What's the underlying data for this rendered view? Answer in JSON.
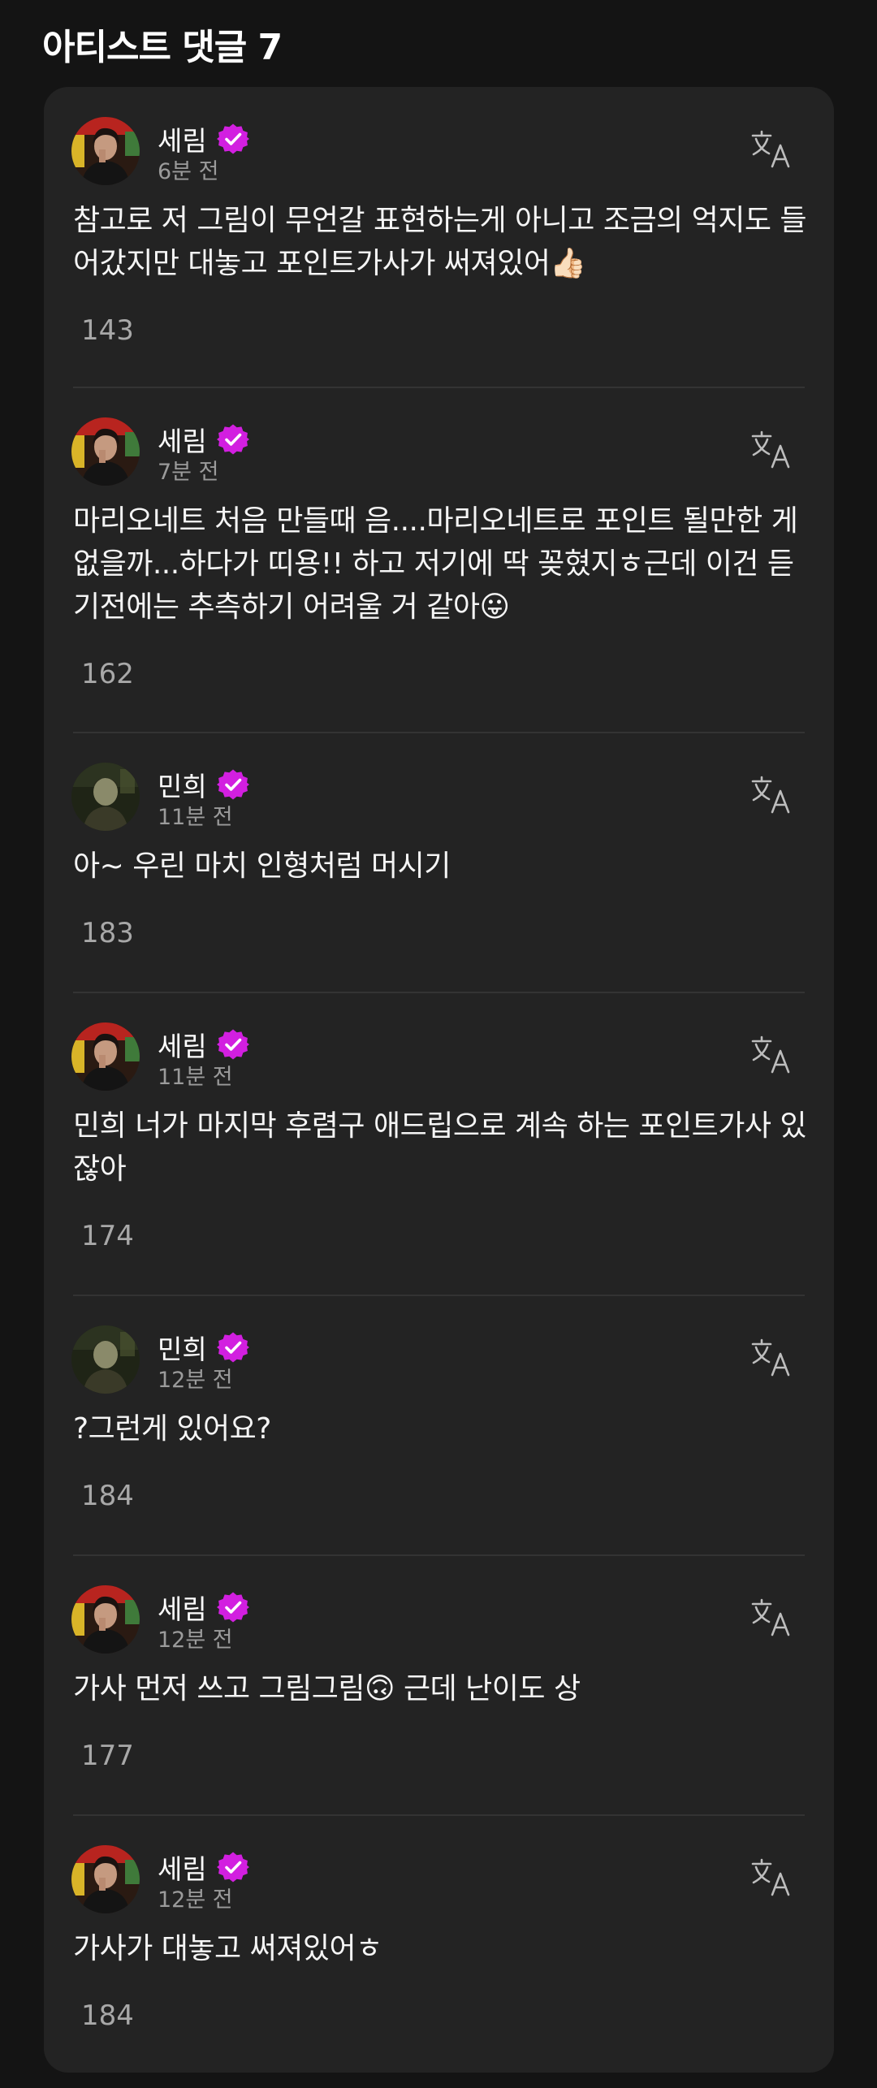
{
  "section": {
    "title": "아티스트 댓글 7"
  },
  "comments": [
    {
      "author": "세림",
      "avatar": "serim",
      "time": "6분 전",
      "text": "참고로 저 그림이 무언갈 표현하는게 아니고 조금의 억지도 들어갔지만 대놓고 포인트가사가 써져있어👍🏻",
      "likes": "143"
    },
    {
      "author": "세림",
      "avatar": "serim",
      "time": "7분 전",
      "text": "마리오네트 처음 만들때 음....마리오네트로 포인트 될만한 게 없을까...하다가 띠용!! 하고 저기에 딱 꽂혔지ㅎ근데 이건 듣기전에는 추측하기 어려울 거 같아😛",
      "likes": "162"
    },
    {
      "author": "민희",
      "avatar": "minhee",
      "time": "11분 전",
      "text": "아~ 우린 마치 인형처럼 머시기",
      "likes": "183"
    },
    {
      "author": "세림",
      "avatar": "serim",
      "time": "11분 전",
      "text": "민희 너가 마지막 후렴구 애드립으로 계속 하는 포인트가사 있잖아",
      "likes": "174"
    },
    {
      "author": "민희",
      "avatar": "minhee",
      "time": "12분 전",
      "text": "?그런게 있어요?",
      "likes": "184"
    },
    {
      "author": "세림",
      "avatar": "serim",
      "time": "12분 전",
      "text": "가사 먼저 쓰고 그림그림🙃 근데 난이도 상",
      "likes": "177"
    },
    {
      "author": "세림",
      "avatar": "serim",
      "time": "12분 전",
      "text": "가사가 대놓고 써져있어ㅎ",
      "likes": "184"
    }
  ],
  "icons": {
    "verified": "verified-badge-icon",
    "translate": "translate-icon",
    "like": "heart-icon"
  },
  "colors": {
    "verified": "#d21fe0",
    "background": "#141414",
    "card": "#232323"
  }
}
